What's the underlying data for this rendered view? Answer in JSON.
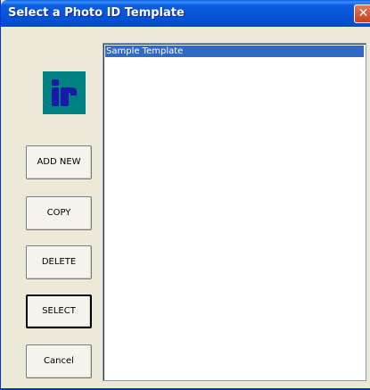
{
  "window": {
    "title": "Select a Photo ID Template",
    "close_glyph": "✕"
  },
  "logo": {
    "icon": "ir-logo-icon",
    "bg_color": "#008080",
    "fg_color": "#1a1aa8"
  },
  "buttons": {
    "add_new": "ADD NEW",
    "copy": "COPY",
    "delete": "DELETE",
    "select": "SELECT",
    "cancel": "Cancel"
  },
  "templates": {
    "items": [
      {
        "label": "Sample Template",
        "selected": true
      }
    ]
  },
  "colors": {
    "selection": "#316ac5",
    "titlebar": "#0553d9"
  }
}
